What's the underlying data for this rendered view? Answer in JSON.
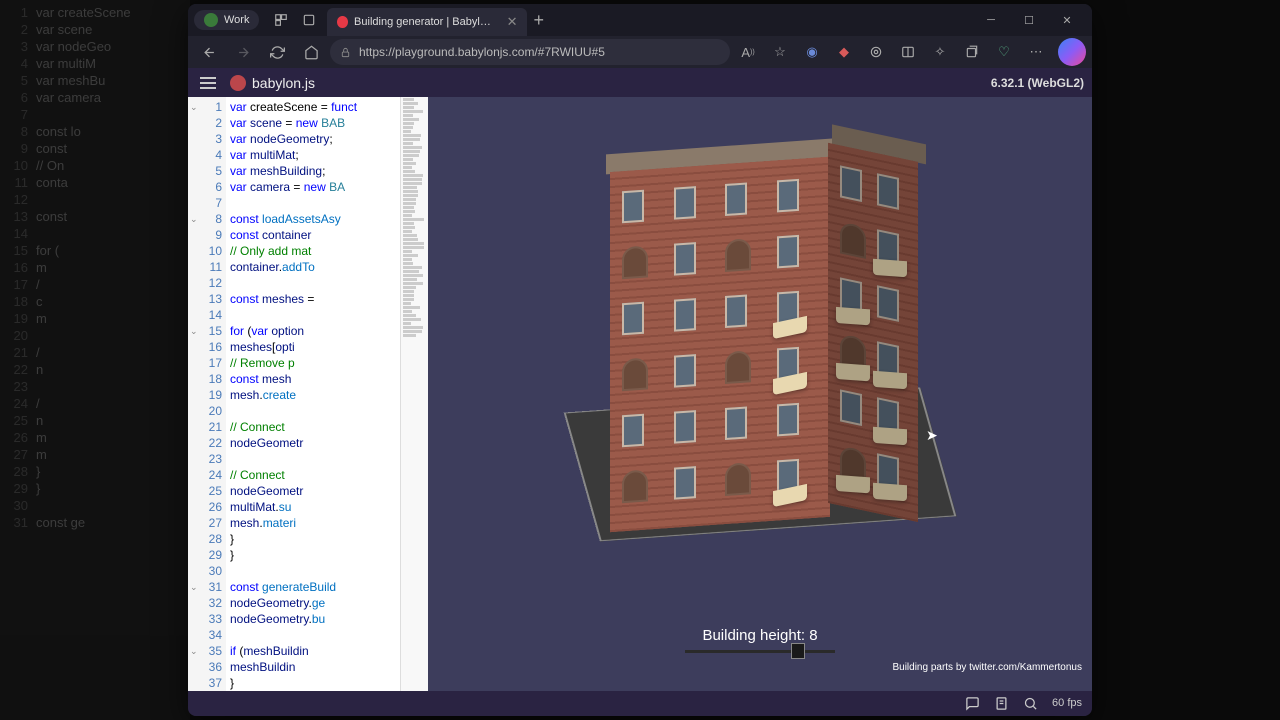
{
  "browser": {
    "profile_label": "Work",
    "tab_title": "Building generator | Babylon.js P",
    "url": "https://playground.babylonjs.com/#7RWIUU#5"
  },
  "app": {
    "name": "babylon.js",
    "version": "6.32.1 (WebGL2)",
    "fps": "60 fps"
  },
  "bg_code": [
    {
      "n": "1",
      "t": "var createScene"
    },
    {
      "n": "2",
      "t": "    var scene"
    },
    {
      "n": "3",
      "t": "    var nodeGeo"
    },
    {
      "n": "4",
      "t": "    var multiM"
    },
    {
      "n": "5",
      "t": "    var meshBu"
    },
    {
      "n": "6",
      "t": "    var camera"
    },
    {
      "n": "7",
      "t": ""
    },
    {
      "n": "8",
      "t": "    const lo"
    },
    {
      "n": "9",
      "t": "        const"
    },
    {
      "n": "10",
      "t": "        // On"
    },
    {
      "n": "11",
      "t": "        conta"
    },
    {
      "n": "12",
      "t": ""
    },
    {
      "n": "13",
      "t": "        const"
    },
    {
      "n": "14",
      "t": ""
    },
    {
      "n": "15",
      "t": "        for ("
    },
    {
      "n": "16",
      "t": "            m"
    },
    {
      "n": "17",
      "t": "            /"
    },
    {
      "n": "18",
      "t": "            c"
    },
    {
      "n": "19",
      "t": "            m"
    },
    {
      "n": "20",
      "t": ""
    },
    {
      "n": "21",
      "t": "            /"
    },
    {
      "n": "22",
      "t": "            n"
    },
    {
      "n": "23",
      "t": ""
    },
    {
      "n": "24",
      "t": "            /"
    },
    {
      "n": "25",
      "t": "            n"
    },
    {
      "n": "26",
      "t": "            m"
    },
    {
      "n": "27",
      "t": "            m"
    },
    {
      "n": "28",
      "t": "        }"
    },
    {
      "n": "29",
      "t": "    }"
    },
    {
      "n": "30",
      "t": ""
    },
    {
      "n": "31",
      "t": "    const ge"
    }
  ],
  "code": {
    "lines": [
      {
        "n": 1,
        "fold": true,
        "html": "<span class='k'>var</span> createScene = <span class='k'>funct</span>"
      },
      {
        "n": 2,
        "html": "    <span class='k'>var</span> <span class='v'>scene</span> = <span class='k'>new</span> <span class='t'>BAB</span>"
      },
      {
        "n": 3,
        "html": "    <span class='k'>var</span> <span class='v'>nodeGeometry</span>;"
      },
      {
        "n": 4,
        "html": "    <span class='k'>var</span> <span class='v'>multiMat</span>;"
      },
      {
        "n": 5,
        "html": "    <span class='k'>var</span> <span class='v'>meshBuilding</span>;"
      },
      {
        "n": 6,
        "html": "    <span class='k'>var</span> <span class='v'>camera</span> = <span class='k'>new</span> <span class='t'>BA</span>"
      },
      {
        "n": 7,
        "html": ""
      },
      {
        "n": 8,
        "fold": true,
        "html": "    <span class='k'>const</span> <span class='n'>loadAssetsAsy</span>"
      },
      {
        "n": 9,
        "html": "        <span class='k'>const</span> <span class='v'>container</span>"
      },
      {
        "n": 10,
        "html": "        <span class='c'>// Only add mat</span>"
      },
      {
        "n": 11,
        "html": "        <span class='v'>container</span>.<span class='n'>addTo</span>"
      },
      {
        "n": 12,
        "html": ""
      },
      {
        "n": 13,
        "html": "        <span class='k'>const</span> <span class='v'>meshes</span> = "
      },
      {
        "n": 14,
        "html": ""
      },
      {
        "n": 15,
        "fold": true,
        "html": "        <span class='k'>for</span> (<span class='k'>var</span> <span class='v'>option</span>"
      },
      {
        "n": 16,
        "html": "            <span class='v'>meshes</span>[<span class='v'>opti</span>"
      },
      {
        "n": 17,
        "html": "            <span class='c'>// Remove p</span>"
      },
      {
        "n": 18,
        "html": "            <span class='k'>const</span> <span class='v'>mesh</span>"
      },
      {
        "n": 19,
        "html": "            <span class='v'>mesh</span>.<span class='n'>create</span>"
      },
      {
        "n": 20,
        "html": ""
      },
      {
        "n": 21,
        "html": "            <span class='c'>// Connect </span>"
      },
      {
        "n": 22,
        "html": "            <span class='v'>nodeGeometr</span>"
      },
      {
        "n": 23,
        "html": ""
      },
      {
        "n": 24,
        "html": "            <span class='c'>// Connect </span>"
      },
      {
        "n": 25,
        "html": "            <span class='v'>nodeGeometr</span>"
      },
      {
        "n": 26,
        "html": "            <span class='v'>multiMat</span>.<span class='n'>su</span>"
      },
      {
        "n": 27,
        "html": "            <span class='v'>mesh</span>.<span class='n'>materi</span>"
      },
      {
        "n": 28,
        "html": "        }"
      },
      {
        "n": 29,
        "html": "    }"
      },
      {
        "n": 30,
        "html": ""
      },
      {
        "n": 31,
        "fold": true,
        "html": "    <span class='k'>const</span> <span class='n'>generateBuild</span>"
      },
      {
        "n": 32,
        "html": "        <span class='v'>nodeGeometry</span>.<span class='n'>ge</span>"
      },
      {
        "n": 33,
        "html": "        <span class='v'>nodeGeometry</span>.<span class='n'>bu</span>"
      },
      {
        "n": 34,
        "html": ""
      },
      {
        "n": 35,
        "fold": true,
        "html": "        <span class='k'>if</span> (<span class='v'>meshBuildin</span>"
      },
      {
        "n": 36,
        "html": "            <span class='v'>meshBuildin</span>"
      },
      {
        "n": 37,
        "html": "        }"
      }
    ]
  },
  "scene": {
    "slider_label": "Building height: 8",
    "slider_value": 8,
    "slider_min": 1,
    "slider_max": 10,
    "credit": "Building parts by twitter.com/Kammertonus"
  },
  "colors": {
    "accent": "#2a2342",
    "canvas_bg": "#3d3d5c",
    "brick": "#9b5a4a"
  }
}
